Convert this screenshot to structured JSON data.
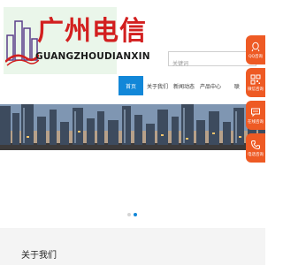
{
  "logo": {
    "title": "广州电信",
    "subtitle": "GUANGZHOUDIANXIN"
  },
  "search": {
    "placeholder": "关键词"
  },
  "nav": {
    "items": [
      {
        "label": "首页",
        "active": true
      },
      {
        "label": "关于我们",
        "active": false
      },
      {
        "label": "新闻动态",
        "active": false
      },
      {
        "label": "产品中心",
        "active": false
      },
      {
        "label": "联",
        "active": false
      }
    ]
  },
  "carousel": {
    "slides": 2,
    "current_slide": 2
  },
  "sections": {
    "about_title": "关于我们"
  },
  "sidebar": {
    "qq_label": "QQ咨询",
    "wechat_label": "微信咨询",
    "online_label": "在线咨询",
    "phone_label": "电话咨询"
  },
  "colors": {
    "accent": "#1287d8",
    "sidebar": "#ee5a24",
    "logo_red": "#d21f1f"
  }
}
